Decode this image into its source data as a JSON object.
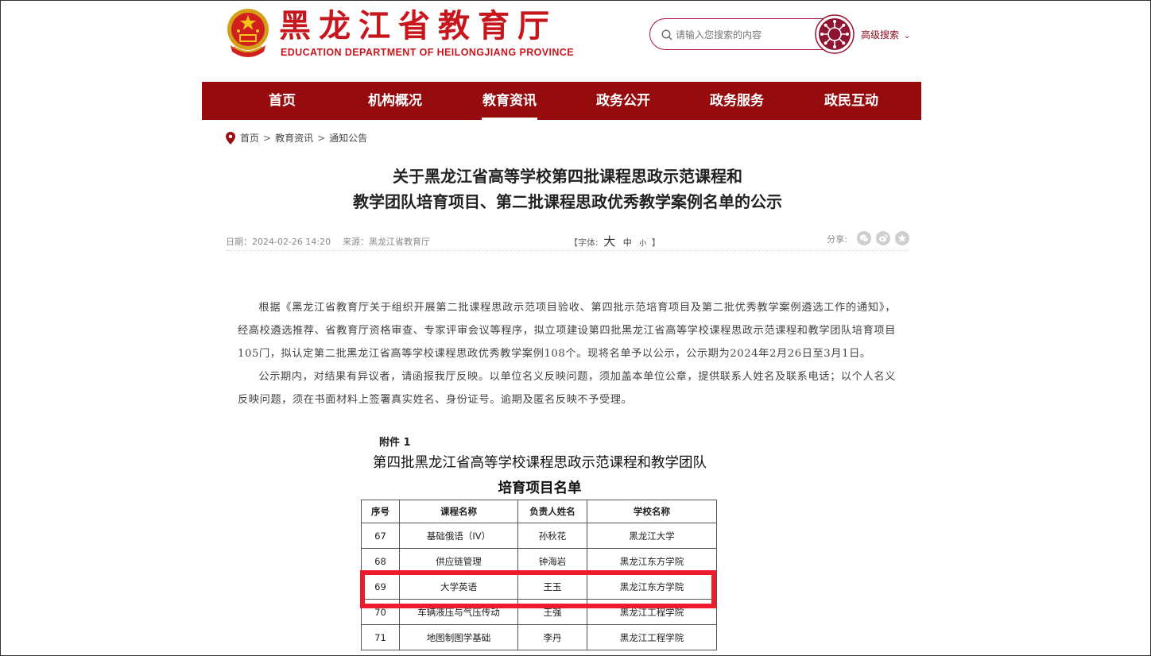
{
  "header": {
    "site_title": "黑龙江省教育厅",
    "site_subtitle": "EDUCATION DEPARTMENT OF HEILONGJIANG PROVINCE",
    "emblem_icon": "national-emblem-icon",
    "search_placeholder": "请输入您搜索的内容",
    "advanced_search_label": "高级搜索",
    "accent_color": "#c8161d"
  },
  "nav": {
    "background_color": "#960c0e",
    "items": [
      {
        "label": "首页"
      },
      {
        "label": "机构概况"
      },
      {
        "label": "教育资讯",
        "active": true
      },
      {
        "label": "政务公开"
      },
      {
        "label": "政务服务"
      },
      {
        "label": "政民互动"
      }
    ]
  },
  "breadcrumb": {
    "items": [
      "首页",
      "教育资讯",
      "通知公告"
    ],
    "separator": ">"
  },
  "article": {
    "title_line1": "关于黑龙江省高等学校第四批课程思政示范课程和",
    "title_line2": "教学团队培育项目、第二批课程思政优秀教学案例名单的公示",
    "date": "日期：2024-02-26 14:20",
    "source": "来源：黑龙江省教育厅",
    "font_label_open": "【字体:",
    "font_big": "大",
    "font_mid": "中",
    "font_small": "小",
    "font_label_close": "】",
    "share_label": "分享:",
    "paragraph1": "根据《黑龙江省教育厅关于组织开展第二批课程思政示范项目验收、第四批示范培育项目及第二批优秀教学案例遴选工作的通知》，经高校遴选推荐、省教育厅资格审查、专家评审会议等程序，拟立项建设第四批黑龙江省高等学校课程思政示范课程和教学团队培育项目105门，拟认定第二批黑龙江省高等学校课程思政优秀教学案例108个。现将名单予以公示，公示期为2024年2月26日至3月1日。",
    "paragraph2": "公示期内，对结果有异议者，请函报我厅反映。以单位名义反映问题，须加盖本单位公章，提供联系人姓名及联系电话；以个人名义反映问题，须在书面材料上签署真实姓名、身份证号。逾期及匿名反映不予受理。"
  },
  "attachment": {
    "label": "附件 1",
    "title_line1": "第四批黑龙江省高等学校课程思政示范课程和教学团队",
    "title_line2": "培育项目名单",
    "table": {
      "headers": [
        "序号",
        "课程名称",
        "负责人姓名",
        "学校名称"
      ],
      "rows": [
        [
          "67",
          "基础俄语（IV）",
          "孙秋花",
          "黑龙江大学"
        ],
        [
          "68",
          "供应链管理",
          "钟海岩",
          "黑龙江东方学院"
        ],
        [
          "69",
          "大学英语",
          "王玉",
          "黑龙江东方学院"
        ],
        [
          "70",
          "车辆液压与气压传动",
          "王强",
          "黑龙江工程学院"
        ],
        [
          "71",
          "地图制图学基础",
          "李丹",
          "黑龙江工程学院"
        ]
      ],
      "highlighted_row_index": 2,
      "highlight_color": "#ec1c2c"
    }
  }
}
